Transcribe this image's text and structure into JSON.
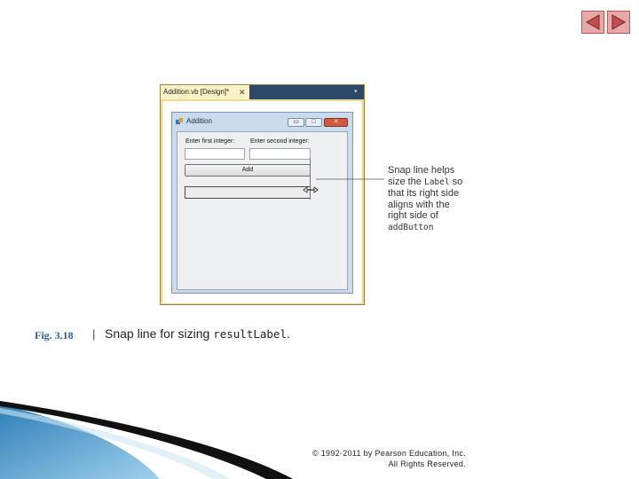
{
  "slide_nav": {
    "prev_icon": "triangle-left-icon",
    "next_icon": "triangle-right-icon",
    "color": "#c0504d"
  },
  "ide": {
    "tab_label": "Addition.vb [Design]*",
    "tab_close": "✕",
    "dropdown_glyph": "▾"
  },
  "form": {
    "title": "Addition",
    "minimize_glyph": "▭",
    "maximize_glyph": "□",
    "close_glyph": "✕",
    "first_label": "Enter first integer:",
    "second_label": "Enter second integer:",
    "first_value": "",
    "second_value": "",
    "add_button": "Add",
    "result_text": ""
  },
  "callout": {
    "line1": "Snap line helps size the ",
    "code1": "Label",
    "line2": " so that its right side aligns with the right side of ",
    "code2": "addButton"
  },
  "caption": {
    "fig_number": "Fig. 3.18",
    "separator": "|",
    "text": "Snap line for sizing ",
    "code": "resultLabel",
    "period": "."
  },
  "footer": {
    "copyright_line1": "© 1992-2011 by Pearson Education, Inc.",
    "copyright_line2": "All Rights Reserved."
  }
}
